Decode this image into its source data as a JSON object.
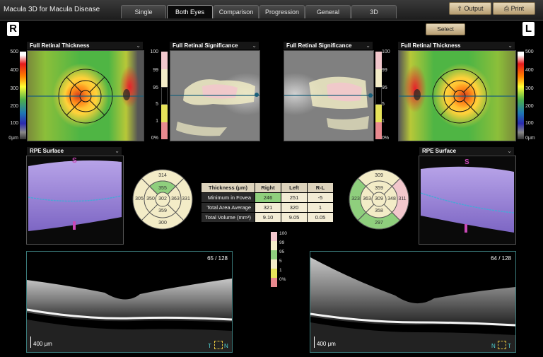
{
  "app_title": "Macula 3D for Macula Disease",
  "tabs": [
    {
      "label": "Single",
      "active": false
    },
    {
      "label": "Both Eyes",
      "active": true
    },
    {
      "label": "Comparison",
      "active": false
    },
    {
      "label": "Progression",
      "active": false
    },
    {
      "label": "General",
      "active": false
    },
    {
      "label": "3D",
      "active": false
    }
  ],
  "toolbar": {
    "output_label": "Output",
    "print_label": "Print",
    "output_icon": "export-icon",
    "print_icon": "printer-icon"
  },
  "eyes": {
    "right_letter": "R",
    "left_letter": "L"
  },
  "select_label": "Select",
  "panels": {
    "right_thickness_title": "Full Retinal Thickness",
    "right_significance_title": "Full Retinal Significance",
    "left_significance_title": "Full Retinal Significance",
    "left_thickness_title": "Full Retinal Thickness",
    "right_rpe_title": "RPE Surface",
    "left_rpe_title": "RPE Surface"
  },
  "thickness_scale": [
    "500",
    "400",
    "300",
    "200",
    "100",
    "0μm"
  ],
  "significance_scale": [
    "100",
    "99",
    "95",
    "5",
    "1",
    "0%"
  ],
  "rpe_compass": {
    "superior": "S",
    "inferior": "I"
  },
  "right_grid": {
    "outer_superior": "314",
    "outer_temporal": "305",
    "outer_nasal": "331",
    "outer_inferior": "300",
    "inner_superior": "355",
    "inner_temporal": "350",
    "inner_nasal": "363",
    "inner_inferior": "359",
    "center": "302"
  },
  "left_grid": {
    "outer_superior": "309",
    "outer_temporal": "323",
    "outer_nasal": "311",
    "outer_inferior": "297",
    "inner_superior": "359",
    "inner_temporal": "363",
    "inner_nasal": "348",
    "inner_inferior": "358",
    "center": "309"
  },
  "table": {
    "headers": [
      "Thickness (μm)",
      "Right",
      "Left",
      "R-L"
    ],
    "rows": [
      {
        "label": "Minimum in Fovea",
        "right": "246",
        "left": "251",
        "diff": "-5"
      },
      {
        "label": "Total Area Average",
        "right": "321",
        "left": "320",
        "diff": "1"
      },
      {
        "label": "Total Volume (mm³)",
        "right": "9.10",
        "left": "9.05",
        "diff": "0.05"
      }
    ]
  },
  "mini_legend": [
    "100",
    "99",
    "95",
    "5",
    "1",
    "0%"
  ],
  "oct": {
    "right_slice": "65 / 128",
    "left_slice": "64 / 128",
    "scale_label": "400 μm",
    "right_orient_left": "T",
    "right_orient_right": "N",
    "left_orient_left": "N",
    "left_orient_right": "T"
  },
  "colors": {
    "significance_pink": "#f2c7cc",
    "significance_cream": "#f3ecc7",
    "significance_green": "#8fcf7d",
    "significance_yellow": "#e7e35a",
    "significance_red": "#e98a8f",
    "rpe_purple": "#9b82d8"
  }
}
